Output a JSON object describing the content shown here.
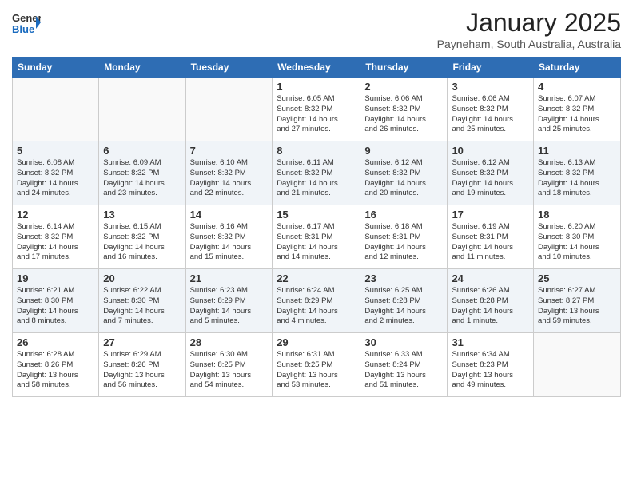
{
  "header": {
    "logo": {
      "line1": "General",
      "line2": "Blue",
      "arrow": "▶"
    },
    "title": "January 2025",
    "subtitle": "Payneham, South Australia, Australia"
  },
  "days_of_week": [
    "Sunday",
    "Monday",
    "Tuesday",
    "Wednesday",
    "Thursday",
    "Friday",
    "Saturday"
  ],
  "weeks": [
    [
      {
        "day": "",
        "info": ""
      },
      {
        "day": "",
        "info": ""
      },
      {
        "day": "",
        "info": ""
      },
      {
        "day": "1",
        "info": "Sunrise: 6:05 AM\nSunset: 8:32 PM\nDaylight: 14 hours\nand 27 minutes."
      },
      {
        "day": "2",
        "info": "Sunrise: 6:06 AM\nSunset: 8:32 PM\nDaylight: 14 hours\nand 26 minutes."
      },
      {
        "day": "3",
        "info": "Sunrise: 6:06 AM\nSunset: 8:32 PM\nDaylight: 14 hours\nand 25 minutes."
      },
      {
        "day": "4",
        "info": "Sunrise: 6:07 AM\nSunset: 8:32 PM\nDaylight: 14 hours\nand 25 minutes."
      }
    ],
    [
      {
        "day": "5",
        "info": "Sunrise: 6:08 AM\nSunset: 8:32 PM\nDaylight: 14 hours\nand 24 minutes."
      },
      {
        "day": "6",
        "info": "Sunrise: 6:09 AM\nSunset: 8:32 PM\nDaylight: 14 hours\nand 23 minutes."
      },
      {
        "day": "7",
        "info": "Sunrise: 6:10 AM\nSunset: 8:32 PM\nDaylight: 14 hours\nand 22 minutes."
      },
      {
        "day": "8",
        "info": "Sunrise: 6:11 AM\nSunset: 8:32 PM\nDaylight: 14 hours\nand 21 minutes."
      },
      {
        "day": "9",
        "info": "Sunrise: 6:12 AM\nSunset: 8:32 PM\nDaylight: 14 hours\nand 20 minutes."
      },
      {
        "day": "10",
        "info": "Sunrise: 6:12 AM\nSunset: 8:32 PM\nDaylight: 14 hours\nand 19 minutes."
      },
      {
        "day": "11",
        "info": "Sunrise: 6:13 AM\nSunset: 8:32 PM\nDaylight: 14 hours\nand 18 minutes."
      }
    ],
    [
      {
        "day": "12",
        "info": "Sunrise: 6:14 AM\nSunset: 8:32 PM\nDaylight: 14 hours\nand 17 minutes."
      },
      {
        "day": "13",
        "info": "Sunrise: 6:15 AM\nSunset: 8:32 PM\nDaylight: 14 hours\nand 16 minutes."
      },
      {
        "day": "14",
        "info": "Sunrise: 6:16 AM\nSunset: 8:32 PM\nDaylight: 14 hours\nand 15 minutes."
      },
      {
        "day": "15",
        "info": "Sunrise: 6:17 AM\nSunset: 8:31 PM\nDaylight: 14 hours\nand 14 minutes."
      },
      {
        "day": "16",
        "info": "Sunrise: 6:18 AM\nSunset: 8:31 PM\nDaylight: 14 hours\nand 12 minutes."
      },
      {
        "day": "17",
        "info": "Sunrise: 6:19 AM\nSunset: 8:31 PM\nDaylight: 14 hours\nand 11 minutes."
      },
      {
        "day": "18",
        "info": "Sunrise: 6:20 AM\nSunset: 8:30 PM\nDaylight: 14 hours\nand 10 minutes."
      }
    ],
    [
      {
        "day": "19",
        "info": "Sunrise: 6:21 AM\nSunset: 8:30 PM\nDaylight: 14 hours\nand 8 minutes."
      },
      {
        "day": "20",
        "info": "Sunrise: 6:22 AM\nSunset: 8:30 PM\nDaylight: 14 hours\nand 7 minutes."
      },
      {
        "day": "21",
        "info": "Sunrise: 6:23 AM\nSunset: 8:29 PM\nDaylight: 14 hours\nand 5 minutes."
      },
      {
        "day": "22",
        "info": "Sunrise: 6:24 AM\nSunset: 8:29 PM\nDaylight: 14 hours\nand 4 minutes."
      },
      {
        "day": "23",
        "info": "Sunrise: 6:25 AM\nSunset: 8:28 PM\nDaylight: 14 hours\nand 2 minutes."
      },
      {
        "day": "24",
        "info": "Sunrise: 6:26 AM\nSunset: 8:28 PM\nDaylight: 14 hours\nand 1 minute."
      },
      {
        "day": "25",
        "info": "Sunrise: 6:27 AM\nSunset: 8:27 PM\nDaylight: 13 hours\nand 59 minutes."
      }
    ],
    [
      {
        "day": "26",
        "info": "Sunrise: 6:28 AM\nSunset: 8:26 PM\nDaylight: 13 hours\nand 58 minutes."
      },
      {
        "day": "27",
        "info": "Sunrise: 6:29 AM\nSunset: 8:26 PM\nDaylight: 13 hours\nand 56 minutes."
      },
      {
        "day": "28",
        "info": "Sunrise: 6:30 AM\nSunset: 8:25 PM\nDaylight: 13 hours\nand 54 minutes."
      },
      {
        "day": "29",
        "info": "Sunrise: 6:31 AM\nSunset: 8:25 PM\nDaylight: 13 hours\nand 53 minutes."
      },
      {
        "day": "30",
        "info": "Sunrise: 6:33 AM\nSunset: 8:24 PM\nDaylight: 13 hours\nand 51 minutes."
      },
      {
        "day": "31",
        "info": "Sunrise: 6:34 AM\nSunset: 8:23 PM\nDaylight: 13 hours\nand 49 minutes."
      },
      {
        "day": "",
        "info": ""
      }
    ]
  ]
}
